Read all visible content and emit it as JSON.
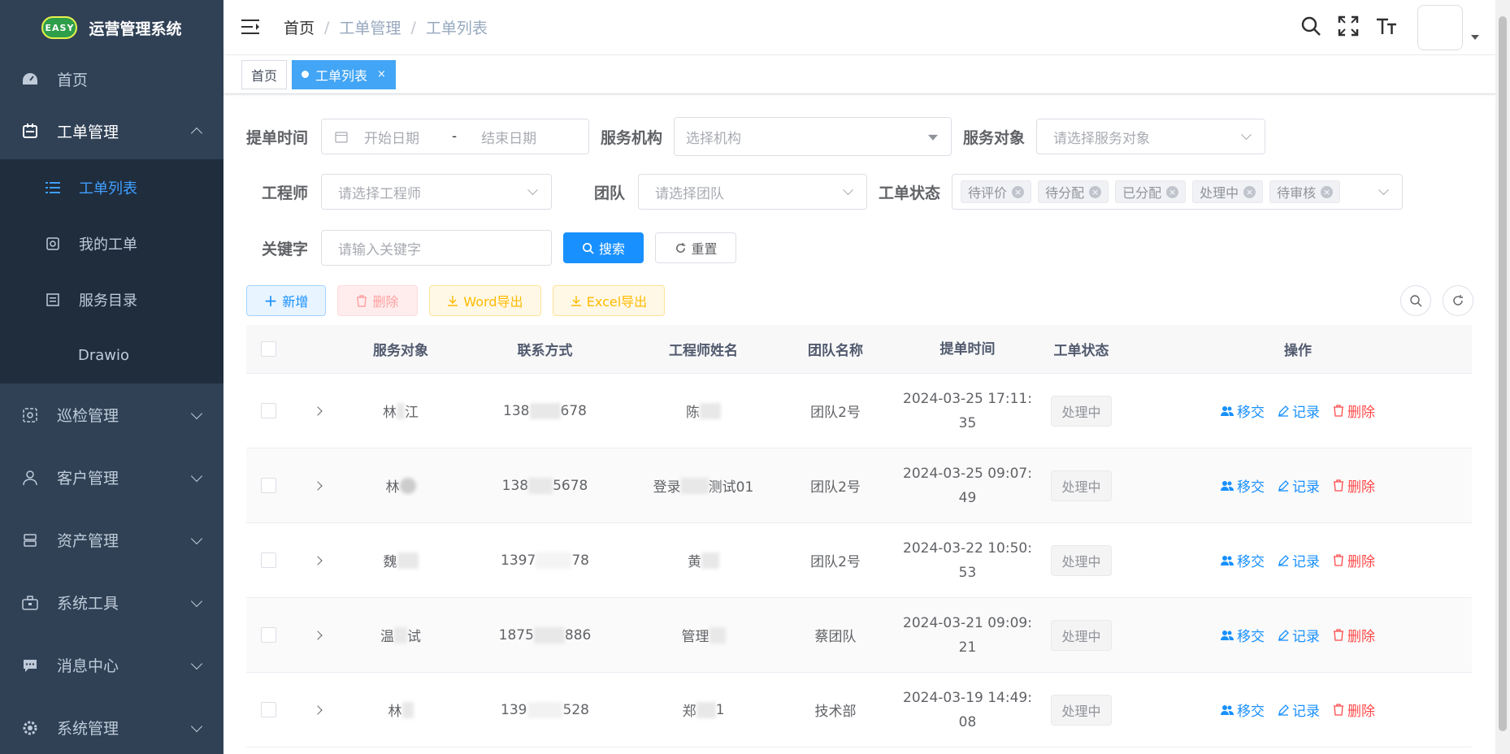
{
  "app": {
    "logo_badge": "EASY",
    "title": "运营管理系统"
  },
  "sidebar": {
    "home": "首页",
    "ticket_mgmt": "工单管理",
    "ticket_sub": [
      {
        "label": "工单列表",
        "active": true
      },
      {
        "label": "我的工单"
      },
      {
        "label": "服务目录"
      },
      {
        "label": "Drawio"
      }
    ],
    "inspection": "巡检管理",
    "customer": "客户管理",
    "asset": "资产管理",
    "tools": "系统工具",
    "message": "消息中心",
    "system": "系统管理"
  },
  "breadcrumb": [
    "首页",
    "工单管理",
    "工单列表"
  ],
  "tags": {
    "home": "首页",
    "active": "工单列表",
    "close": "×"
  },
  "filters": {
    "submit_time_label": "提单时间",
    "date_sep": "-",
    "start_placeholder": "开始日期",
    "end_placeholder": "结束日期",
    "org_label": "服务机构",
    "org_placeholder": "选择机构",
    "target_label": "服务对象",
    "target_placeholder": "请选择服务对象",
    "engineer_label": "工程师",
    "engineer_placeholder": "请选择工程师",
    "team_label": "团队",
    "team_placeholder": "请选择团队",
    "status_label": "工单状态",
    "status_tags": [
      "待评价",
      "待分配",
      "已分配",
      "处理中",
      "待审核"
    ],
    "keyword_label": "关键字",
    "keyword_placeholder": "请输入关键字",
    "search_btn": "搜索",
    "reset_btn": "重置"
  },
  "toolbar": {
    "add": "新增",
    "delete": "删除",
    "word": "Word导出",
    "excel": "Excel导出"
  },
  "table": {
    "headers": {
      "obj": "服务对象",
      "contact": "联系方式",
      "eng": "工程师姓名",
      "team": "团队名称",
      "time": "提单时间",
      "status": "工单状态",
      "ops": "操作"
    },
    "ops": {
      "transfer": "移交",
      "record": "记录",
      "delete": "删除"
    },
    "rows": [
      {
        "obj_a": "林",
        "obj_b": "江",
        "contact_a": "138",
        "contact_b": "678",
        "eng_a": "陈",
        "eng_b": "",
        "team": "团队2号",
        "time_a": "2024-03-25 17:11:",
        "time_b": "35",
        "status": "处理中"
      },
      {
        "obj_a": "林",
        "obj_b": "",
        "contact_a": "138",
        "contact_b": "5678",
        "eng_a": "登录",
        "eng_b": "测试01",
        "team": "团队2号",
        "time_a": "2024-03-25 09:07:",
        "time_b": "49",
        "status": "处理中"
      },
      {
        "obj_a": "魏",
        "obj_b": "",
        "contact_a": "1397",
        "contact_b": "78",
        "eng_a": "黄",
        "eng_b": "",
        "team": "团队2号",
        "time_a": "2024-03-22 10:50:",
        "time_b": "53",
        "status": "处理中"
      },
      {
        "obj_a": "温",
        "obj_b": "试",
        "contact_a": "1875",
        "contact_b": "886",
        "eng_a": "管理",
        "eng_b": "",
        "team": "蔡团队",
        "time_a": "2024-03-21 09:09:",
        "time_b": "21",
        "status": "处理中"
      },
      {
        "obj_a": "林",
        "obj_b": "",
        "contact_a": "139",
        "contact_b": "528",
        "eng_a": "郑",
        "eng_b": "1",
        "team": "技术部",
        "time_a": "2024-03-19 14:49:",
        "time_b": "08",
        "status": "处理中"
      }
    ]
  }
}
